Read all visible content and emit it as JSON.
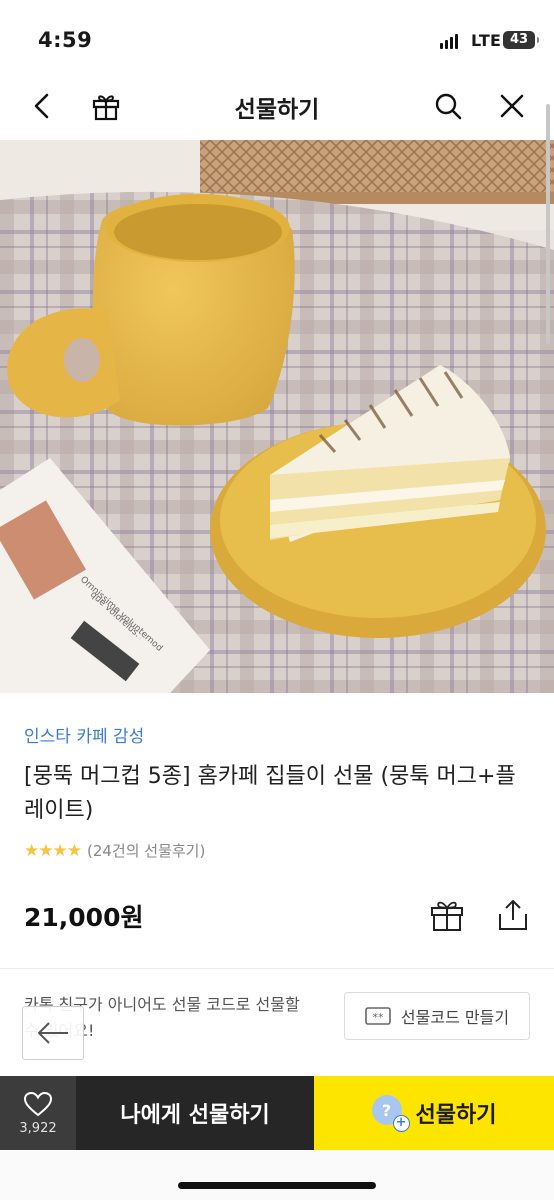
{
  "status_bar": {
    "time": "4:59",
    "network": "LTE",
    "battery": "43"
  },
  "header": {
    "title": "선물하기",
    "icons": [
      "back-arrow-icon",
      "gift-box-icon",
      "search-icon",
      "close-icon"
    ]
  },
  "product": {
    "category": "인스타 카페 감성",
    "title": "[뭉뚝 머그컵 5종] 홈카페 집들이 선물 (뭉툭 머그+플레이트)",
    "rating_stars": 4,
    "stars_text": "★★★★",
    "review_text": "(24건의 선물후기)",
    "price": "21,000원"
  },
  "promo": {
    "text": "카톡 친구가 아니어도 선물 코드로 선물할 수 있어요!",
    "code_button_label": "선물코드 만들기"
  },
  "bottom_bar": {
    "like_count": "3,922",
    "self_gift_label": "나에게 선물하기",
    "gift_label": "선물하기",
    "gift_avatar_glyph": "?",
    "gift_plus_glyph": "+"
  },
  "colors": {
    "accent_yellow": "#fee500",
    "dark_button": "#262626",
    "like_box": "#3c3c3c",
    "category_blue": "#3a7bd5",
    "star": "#f6c343"
  }
}
